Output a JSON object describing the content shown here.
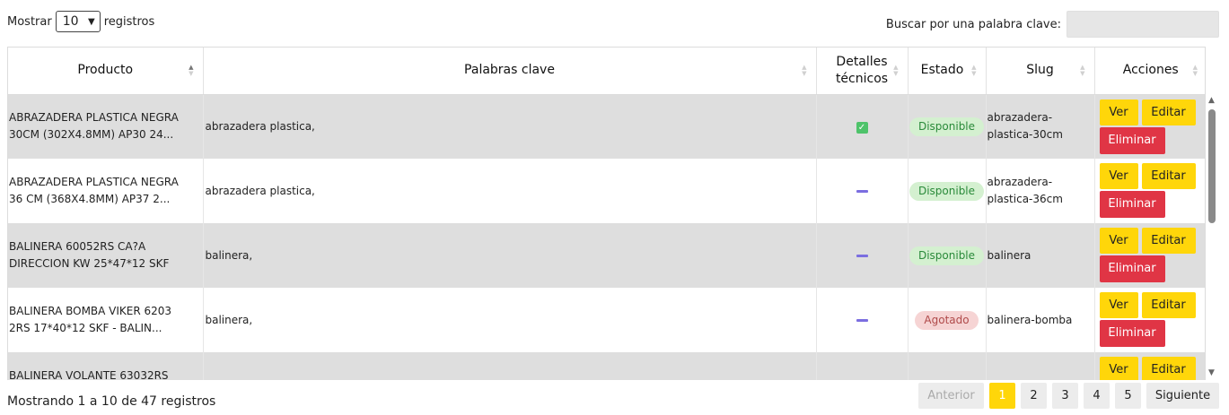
{
  "length_menu": {
    "before": "Mostrar",
    "value": "10",
    "after": "registros"
  },
  "search": {
    "label": "Buscar por una palabra clave:"
  },
  "table": {
    "headers": [
      "Producto",
      "Palabras clave",
      "Detalles técnicos",
      "Estado",
      "Slug",
      "Acciones"
    ],
    "rows": [
      {
        "producto": "ABRAZADERA PLASTICA NEGRA 30CM (302X4.8MM) AP30 24...",
        "palabras": "abrazadera plastica,",
        "detalles": "check",
        "estado": "Disponible",
        "slug": "abrazadera-plastica-30cm",
        "ver": "Ver",
        "editar": "Editar",
        "eliminar": "Eliminar"
      },
      {
        "producto": "ABRAZADERA PLASTICA NEGRA 36 CM (368X4.8MM) AP37 2...",
        "palabras": "abrazadera plastica,",
        "detalles": "dash",
        "estado": "Disponible",
        "slug": "abrazadera-plastica-36cm",
        "ver": "Ver",
        "editar": "Editar",
        "eliminar": "Eliminar"
      },
      {
        "producto": "BALINERA 60052RS CA?A DIRECCION KW 25*47*12 SKF",
        "palabras": "balinera,",
        "detalles": "dash",
        "estado": "Disponible",
        "slug": "balinera",
        "ver": "Ver",
        "editar": "Editar",
        "eliminar": "Eliminar"
      },
      {
        "producto": "BALINERA BOMBA VIKER 6203 2RS 17*40*12 SKF - BALIN...",
        "palabras": "balinera,",
        "detalles": "dash",
        "estado": "Agotado",
        "slug": "balinera-bomba",
        "ver": "Ver",
        "editar": "Editar",
        "eliminar": "Eliminar"
      },
      {
        "producto": "BALINERA VOLANTE 63032RS",
        "palabras": "",
        "detalles": "",
        "estado": "",
        "slug": "",
        "ver": "Ver",
        "editar": "Editar",
        "eliminar": ""
      }
    ]
  },
  "info": "Mostrando 1 a 10 de 47 registros",
  "pagination": {
    "prev": "Anterior",
    "pages": [
      "1",
      "2",
      "3",
      "4",
      "5"
    ],
    "active": "1",
    "next": "Siguiente"
  },
  "colors": {
    "yellow": "#ffd60a",
    "red": "#e03545",
    "row_stripe": "#dedede"
  }
}
